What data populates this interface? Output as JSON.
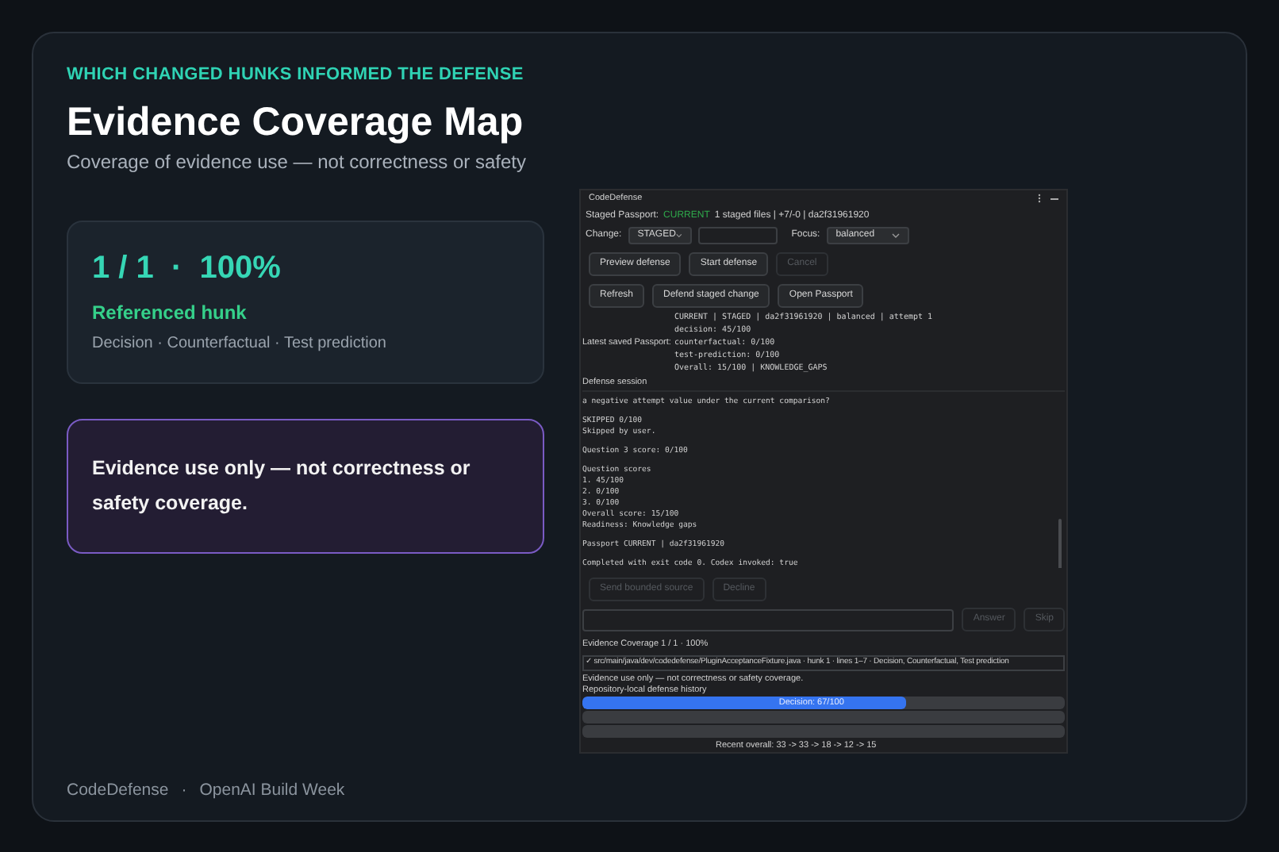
{
  "header": {
    "eyebrow": "WHICH CHANGED HUNKS INFORMED THE DEFENSE",
    "title": "Evidence Coverage Map",
    "subtitle": "Coverage of evidence use — not correctness or safety"
  },
  "stat_card": {
    "value": "1 / 1  ·  100%",
    "label": "Referenced hunk",
    "detail": "Decision · Counterfactual · Test prediction"
  },
  "note_card": {
    "text": "Evidence use only — not correctness or safety coverage."
  },
  "app_window": {
    "title": "CodeDefense",
    "staged": {
      "label": "Staged Passport:",
      "status": "CURRENT",
      "detail": "1 staged files | +7/-0 | da2f31961920"
    },
    "change": {
      "label": "Change:",
      "value": "STAGED"
    },
    "focus": {
      "label": "Focus:",
      "value": "balanced"
    },
    "button_rows": [
      [
        {
          "label": "Preview defense",
          "disabled": false
        },
        {
          "label": "Start defense",
          "disabled": false
        },
        {
          "label": "Cancel",
          "disabled": true
        }
      ],
      [
        {
          "label": "Refresh",
          "disabled": false
        },
        {
          "label": "Defend staged change",
          "disabled": false
        },
        {
          "label": "Open Passport",
          "disabled": false
        }
      ]
    ],
    "passport": {
      "label": "Latest saved Passport:",
      "lines": [
        "CURRENT | STAGED | da2f31961920 | balanced | attempt 1",
        "decision: 45/100",
        "counterfactual: 0/100",
        "test-prediction: 0/100",
        "Overall: 15/100 | KNOWLEDGE_GAPS"
      ]
    },
    "session": {
      "title": "Defense session",
      "blocks": [
        [
          "a negative attempt value under the current comparison?"
        ],
        [
          "SKIPPED 0/100",
          "Skipped by user."
        ],
        [
          "Question 3 score: 0/100"
        ],
        [
          "Question scores",
          "1. 45/100",
          "2. 0/100",
          "3. 0/100",
          "Overall score: 15/100",
          "Readiness: Knowledge gaps"
        ],
        [
          "Passport CURRENT | da2f31961920"
        ],
        [
          "Completed with exit code 0. Codex invoked: true"
        ]
      ]
    },
    "source_buttons": [
      {
        "label": "Send bounded source",
        "disabled": true
      },
      {
        "label": "Decline",
        "disabled": true
      }
    ],
    "answer_buttons": [
      {
        "label": "Answer",
        "disabled": true
      },
      {
        "label": "Skip",
        "disabled": true
      }
    ],
    "coverage": {
      "title": "Evidence Coverage 1 / 1 · 100%",
      "item": "✓ src/main/java/dev/codedefense/PluginAcceptanceFixture.java · hunk 1 · lines 1–7 · Decision, Counterfactual, Test prediction",
      "note": "Evidence use only — not correctness or safety coverage."
    },
    "history": {
      "title": "Repository-local defense history",
      "bars": [
        {
          "kind": "filled",
          "label": "Decision: 67/100",
          "level": 0.67
        },
        {
          "kind": "empty"
        },
        {
          "kind": "empty"
        }
      ],
      "recent": "Recent overall: 33 -> 33 -> 18 -> 12 -> 15"
    }
  },
  "footer": {
    "brand": "CodeDefense",
    "separator": "·",
    "event": "OpenAI Build Week"
  }
}
